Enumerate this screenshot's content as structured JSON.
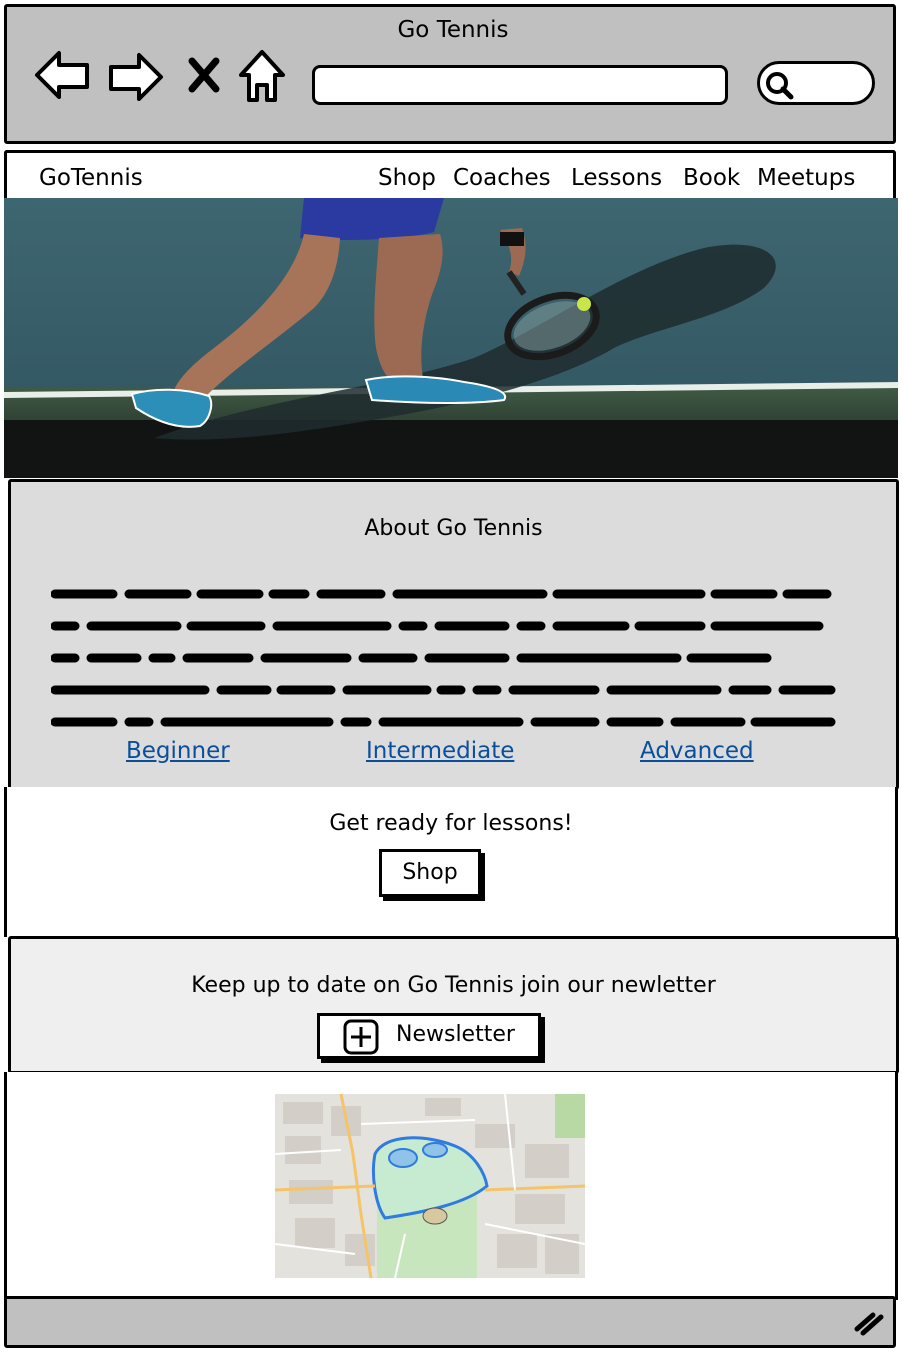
{
  "browser": {
    "window_title": "Go Tennis",
    "icons": [
      "back-arrow-icon",
      "forward-arrow-icon",
      "close-x-icon",
      "home-icon",
      "search-icon"
    ],
    "address_value": "",
    "chrome_color": "#c0c0c0"
  },
  "header": {
    "logo": "GoTennis",
    "nav": [
      "Shop",
      "Coaches",
      "Lessons",
      "Book",
      "Meetups"
    ]
  },
  "about": {
    "title": "About Go Tennis",
    "levels": [
      "Beginner",
      "Intermediate",
      "Advanced"
    ],
    "link_color": "#0b4f9c"
  },
  "lessons": {
    "text": "Get ready for lessons!",
    "button_label": "Shop"
  },
  "newsletter": {
    "text": "Keep up to date on Go Tennis join our newletter",
    "button_label": "Newsletter",
    "button_icon": "plus-box-icon"
  },
  "footer": {
    "icon": "resize-handle-icon"
  }
}
